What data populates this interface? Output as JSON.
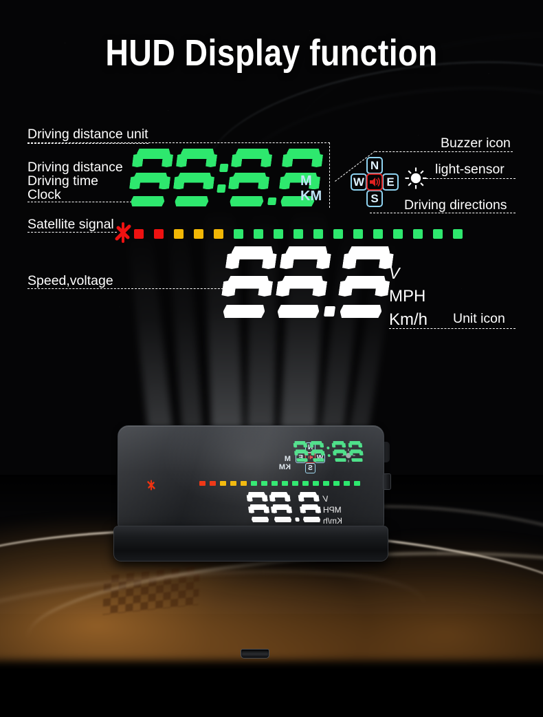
{
  "page": {
    "title": "HUD Display function",
    "background_color": "#050506",
    "accent_green": "#2EE86E",
    "accent_blue": "#8FD4F2",
    "accent_red": "#E02020",
    "accent_amber": "#F2B705",
    "floor_glow": "#D68C3A"
  },
  "callouts": {
    "driving_distance_unit": "Driving distance unit",
    "driving_distance": "Driving distance",
    "driving_time": "Driving time",
    "clock": "Clock",
    "satellite_signal": "Satellite signal",
    "speed_voltage": "Speed,voltage",
    "buzzer_icon": "Buzzer icon",
    "light_sensor": "light-sensor",
    "driving_directions": "Driving directions",
    "unit_icon": "Unit icon"
  },
  "display": {
    "green_readout": {
      "value": "88:8.8",
      "digits": [
        "8",
        "8",
        "8",
        "8"
      ],
      "colon": true,
      "decimal_point": true,
      "color": "#2EE86E",
      "units": [
        "M",
        "KM"
      ],
      "units_color": "#BFE4F7"
    },
    "speed_readout": {
      "value": "88.8",
      "digits": [
        "8",
        "8",
        "8"
      ],
      "decimal_point": true,
      "color": "#FFFFFF",
      "units": [
        "V",
        "MPH",
        "Km/h"
      ]
    },
    "compass": {
      "north": "N",
      "west": "W",
      "east": "E",
      "south": "S",
      "center_icon": "buzzer-icon",
      "box_color": "#8FD4F2",
      "buzzer_color": "#E02020"
    },
    "light_sensor_icon": "sun-icon",
    "satellite_icon": "satellite-icon",
    "signal_bar": {
      "total_segments": 17,
      "colors": [
        "#EE1111",
        "#EE1111",
        "#F2B705",
        "#F2B705",
        "#F2B705",
        "#2EE86E",
        "#2EE86E",
        "#2EE86E",
        "#2EE86E",
        "#2EE86E",
        "#2EE86E",
        "#2EE86E",
        "#2EE86E",
        "#2EE86E",
        "#2EE86E",
        "#2EE86E",
        "#2EE86E"
      ]
    }
  },
  "device": {
    "name": "hud-unit-photo",
    "port": "usb-port",
    "side_button": "side-button",
    "screen_readout_green": "8.8:8.8",
    "screen_readout_white": "8.88",
    "screen_units_green": [
      "M",
      "KM"
    ],
    "screen_units_white": [
      "V",
      "MPH",
      "Km/h"
    ],
    "screen_compass": [
      "N",
      "W",
      "E",
      "S"
    ],
    "screen_signal_colors": [
      "#2EE86E",
      "#2EE86E",
      "#2EE86E",
      "#2EE86E",
      "#2EE86E",
      "#2EE86E",
      "#2EE86E",
      "#2EE86E",
      "#2EE86E",
      "#2EE86E",
      "#2EE86E",
      "#F2B705",
      "#F2B705",
      "#F2B705",
      "#EE3311",
      "#EE3311"
    ]
  }
}
